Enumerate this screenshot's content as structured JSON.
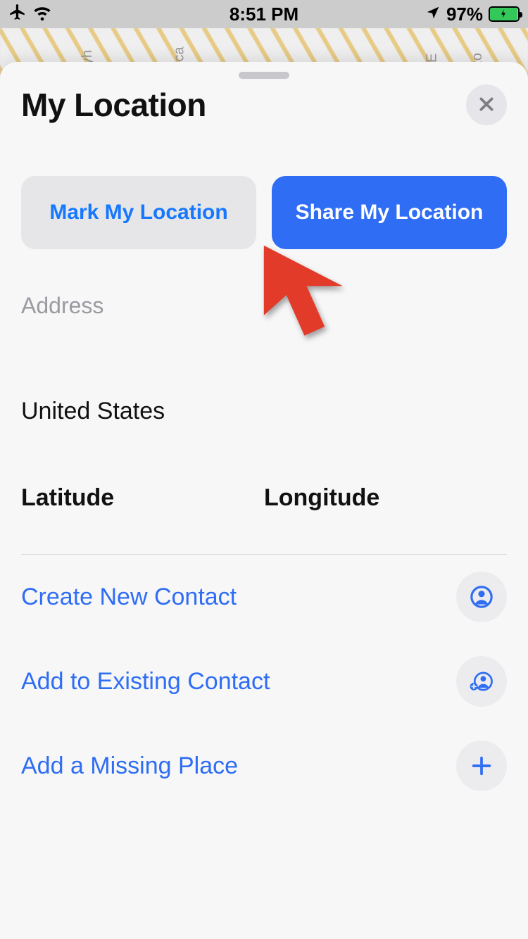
{
  "status_bar": {
    "time": "8:51 PM",
    "battery_percent": "97%"
  },
  "map": {
    "street1": "omyh",
    "street2": "Lorca",
    "street3": "NE",
    "street4": "Ozo"
  },
  "sheet": {
    "title": "My Location",
    "mark_button": "Mark My Location",
    "share_button": "Share My Location",
    "address_heading": "Address",
    "country": "United States",
    "latitude_label": "Latitude",
    "longitude_label": "Longitude",
    "actions": {
      "create_contact": "Create New Contact",
      "add_existing": "Add to Existing Contact",
      "add_place": "Add a Missing Place"
    }
  }
}
